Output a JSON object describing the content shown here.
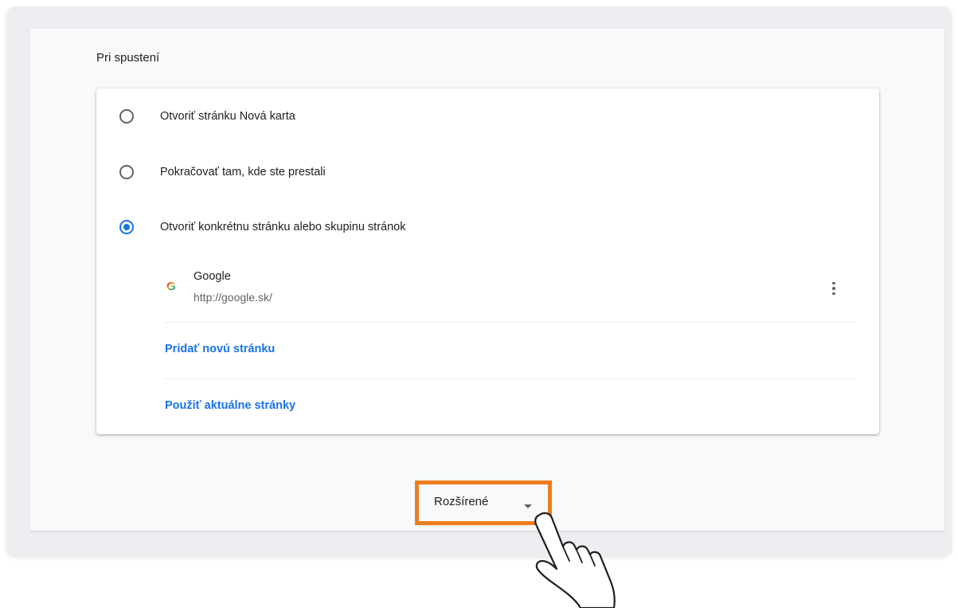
{
  "section": {
    "title": "Pri spustení"
  },
  "startup_options": [
    {
      "label": "Otvoriť stránku Nová karta",
      "selected": false
    },
    {
      "label": "Pokračovať tam, kde ste prestali",
      "selected": false
    },
    {
      "label": "Otvoriť konkrétnu stránku alebo skupinu stránok",
      "selected": true
    }
  ],
  "startup_page": {
    "favicon": "google-g-icon",
    "name": "Google",
    "url": "http://google.sk/",
    "menu_icon": "more-vert-icon"
  },
  "links": {
    "add_page": "Pridať novú stránku",
    "use_current": "Použiť aktuálne stránky"
  },
  "advanced": {
    "label": "Rozšírené",
    "icon": "caret-down-icon"
  },
  "colors": {
    "accent": "#1a73e8",
    "highlight": "#ee7d1f",
    "page_bg": "#f8f9fa"
  }
}
